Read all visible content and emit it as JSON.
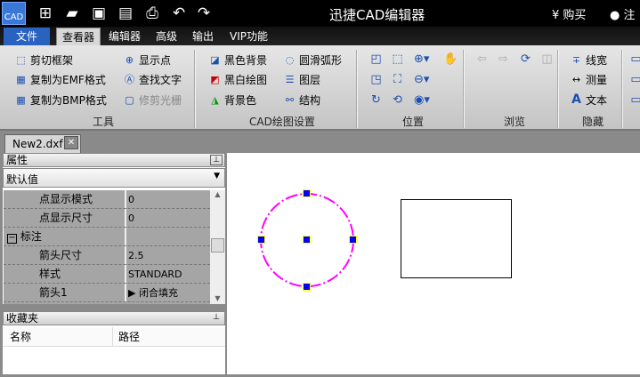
{
  "app": {
    "title": "迅捷CAD编辑器",
    "logo": "CAD",
    "buy": "购买",
    "register": "注"
  },
  "quick_access": [
    "new-icon",
    "open-icon",
    "save-icon",
    "save-pdf-icon",
    "print-icon",
    "undo-icon",
    "redo-icon"
  ],
  "tabs": [
    "文件",
    "查看器",
    "编辑器",
    "高级",
    "输出",
    "VIP功能"
  ],
  "ribbon": {
    "tools": {
      "label": "工具",
      "items": [
        "剪切框架",
        "复制为EMF格式",
        "复制为BMP格式",
        "显示点",
        "查找文字",
        "修剪光栅"
      ]
    },
    "cad": {
      "label": "CAD绘图设置",
      "items": [
        "黑色背景",
        "黑白绘图",
        "背景色",
        "圆滑弧形",
        "图层",
        "结构"
      ]
    },
    "position": {
      "label": "位置"
    },
    "browse": {
      "label": "浏览"
    },
    "hide": {
      "label": "隐藏",
      "items": [
        "线宽",
        "测量",
        "文本"
      ]
    }
  },
  "document": {
    "tab": "New2.dxf"
  },
  "properties": {
    "title": "属性",
    "combo": "默认值",
    "rows": [
      {
        "k": "点显示模式",
        "v": "0"
      },
      {
        "k": "点显示尺寸",
        "v": "0"
      },
      {
        "k": "标注",
        "v": ""
      },
      {
        "k": "箭头尺寸",
        "v": "2.5"
      },
      {
        "k": "样式",
        "v": "STANDARD"
      },
      {
        "k": "箭头1",
        "v": "闭合填充"
      }
    ]
  },
  "favorites": {
    "title": "收藏夹",
    "columns": [
      "名称",
      "路径"
    ]
  },
  "colors": {
    "accent": "#2a62c0",
    "circle": "#ff00ff",
    "grip": "#0000ff"
  }
}
